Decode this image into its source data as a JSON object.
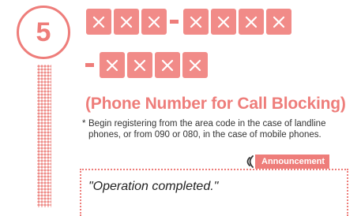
{
  "step": {
    "number": "5"
  },
  "number_format": {
    "first_group_count": 3,
    "second_group_count": 4,
    "third_group_count": 4,
    "placeholder_icon": "x-icon"
  },
  "title": "(Phone Number for Call Blocking)",
  "note": {
    "marker": "*",
    "line1": "Begin registering from the area code in the case of landline",
    "line2": "phones, or from 090 or 080, in the case of mobile phones."
  },
  "announcement": {
    "tag_label": "Announcement",
    "icon": "sound-waves-icon",
    "quote": "\"Operation completed.\""
  },
  "colors": {
    "accent": "#ee7d7a",
    "box_fill": "#f18b88",
    "text": "#333333"
  }
}
